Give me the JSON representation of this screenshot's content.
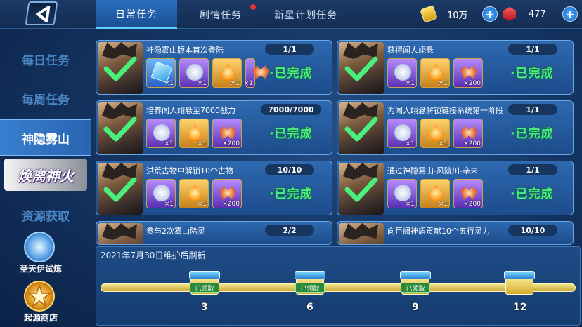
{
  "tabs": [
    {
      "label": "日常任务"
    },
    {
      "label": "剧情任务"
    },
    {
      "label": "新星计划任务"
    }
  ],
  "currency": {
    "gold": "10万",
    "gems": "477"
  },
  "sidebar": {
    "items": [
      {
        "label": "每日任务"
      },
      {
        "label": "每周任务"
      },
      {
        "label": "神隐雾山"
      },
      {
        "label": "焕离神火"
      },
      {
        "label": "资源获取"
      }
    ],
    "trial": "圣天伊试炼",
    "shop": "起源商店"
  },
  "quests": [
    {
      "title": "神隐雾山版本首次登陆",
      "progress": "1/1",
      "status": "·已完成",
      "rewards": [
        "×1",
        "×1",
        "×1",
        "×1"
      ]
    },
    {
      "title": "获得闻人翊悬",
      "progress": "1/1",
      "status": "·已完成",
      "rewards": [
        "×1",
        "×1",
        "×200"
      ]
    },
    {
      "title": "培养闻人翊悬至7000战力",
      "progress": "7000/7000",
      "status": "·已完成",
      "rewards": [
        "×1",
        "×1",
        "×200"
      ]
    },
    {
      "title": "为闻人翊悬解锁链接系统第一阶段",
      "progress": "1/1",
      "status": "·已完成",
      "rewards": [
        "×1",
        "×1",
        "×200"
      ]
    },
    {
      "title": "洪荒古物中解锁10个古物",
      "progress": "10/10",
      "status": "·已完成",
      "rewards": [
        "×1",
        "×1",
        "×200"
      ]
    },
    {
      "title": "通过神隐雾山-风陵川-辛未",
      "progress": "1/1",
      "status": "·已完成",
      "rewards": [
        "×1",
        "×1",
        "×200"
      ]
    },
    {
      "title": "参与2次雾山除灵",
      "progress": "2/2"
    },
    {
      "title": "向巨阙神盾贡献10个五行灵力",
      "progress": "10/10"
    }
  ],
  "bottom": {
    "refresh": "2021年7月30日维护后刷新",
    "milestones": [
      {
        "value": "3",
        "claimed": "已领取"
      },
      {
        "value": "6",
        "claimed": "已领取"
      },
      {
        "value": "9",
        "claimed": "已领取"
      },
      {
        "value": "12"
      }
    ]
  }
}
